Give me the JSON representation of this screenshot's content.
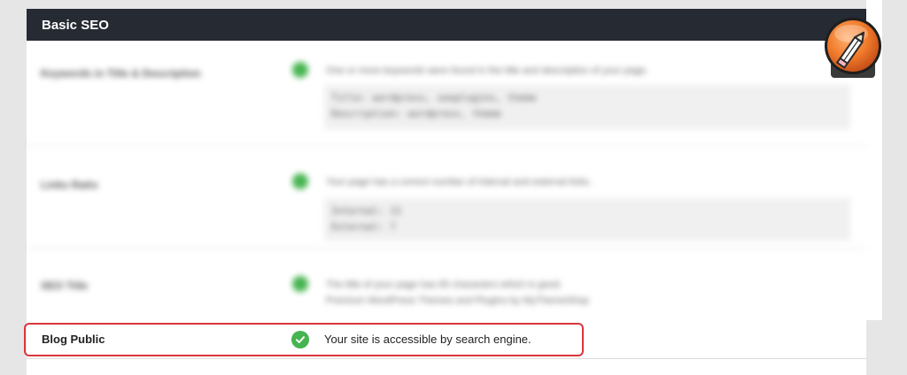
{
  "section": {
    "title": "Basic SEO"
  },
  "rows": [
    {
      "name": "Keywords in Title & Description",
      "description": "One or more keywords were found in the title and description of your page.",
      "code_lines": [
        "Title: wordpress, seoplugins, theme",
        "Description: wordpress, theme"
      ]
    },
    {
      "name": "Links Ratio",
      "description": "Your page has a correct number of internal and external links.",
      "code_lines": [
        "Internal: 11",
        "External: 7"
      ]
    },
    {
      "name": "SEO Title",
      "description": "The title of your page has 65 characters which is good.",
      "code_lines": [
        "Premium WordPress Themes and Plugins by MyThemeShop"
      ]
    }
  ],
  "blog_public": {
    "name": "Blog Public",
    "description": "Your site is accessible by search engine."
  },
  "colors": {
    "header": "#262a33",
    "check": "#46b450",
    "highlight": "#d9363e",
    "badge": "#f07a2a"
  },
  "icons": {
    "check": "check-circle-icon",
    "edit": "pencil-icon"
  }
}
